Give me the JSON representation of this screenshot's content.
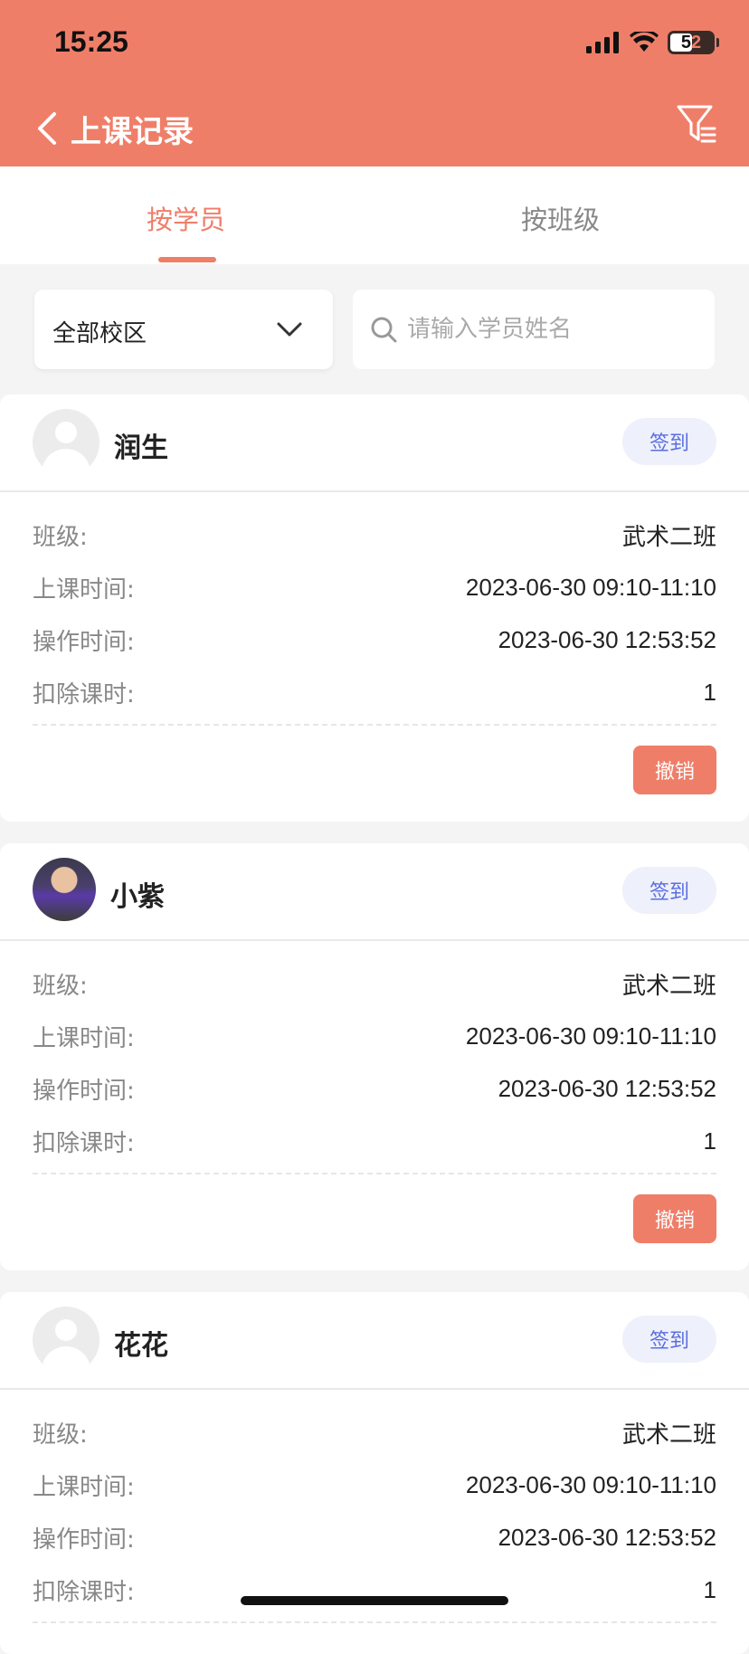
{
  "status_bar": {
    "time": "15:25",
    "battery": [
      "5",
      "2"
    ]
  },
  "header": {
    "title": "上课记录"
  },
  "tabs": [
    {
      "label": "按学员",
      "active": true
    },
    {
      "label": "按班级",
      "active": false
    }
  ],
  "filters": {
    "campus": "全部校区",
    "search_placeholder": "请输入学员姓名"
  },
  "labels": {
    "class": "班级:",
    "class_time": "上课时间:",
    "op_time": "操作时间:",
    "deduct": "扣除课时:",
    "checkin": "签到",
    "revoke": "撤销"
  },
  "records": [
    {
      "name": "润生",
      "class": "武术二班",
      "class_time": "2023-06-30 09:10-11:10",
      "op_time": "2023-06-30 12:53:52",
      "deduct": "1"
    },
    {
      "name": "小紫",
      "class": "武术二班",
      "class_time": "2023-06-30 09:10-11:10",
      "op_time": "2023-06-30 12:53:52",
      "deduct": "1"
    },
    {
      "name": "花花",
      "class": "武术二班",
      "class_time": "2023-06-30 09:10-11:10",
      "op_time": "2023-06-30 12:53:52",
      "deduct": "1"
    }
  ],
  "colors": {
    "accent": "#ef7e69",
    "checkin_text": "#5a6ee0",
    "checkin_bg": "#eef0fb"
  }
}
